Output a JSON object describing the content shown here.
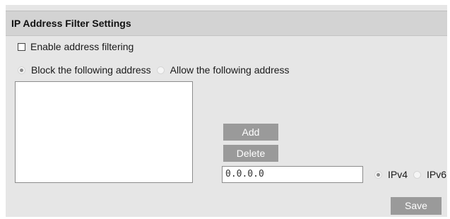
{
  "panel": {
    "title": "IP Address Filter Settings"
  },
  "enable_filter": {
    "label": "Enable address filtering",
    "checked": false
  },
  "mode": {
    "block_label": "Block the following address",
    "allow_label": "Allow the following address",
    "selected": "block"
  },
  "address_list": {
    "items": []
  },
  "buttons": {
    "add_label": "Add",
    "delete_label": "Delete",
    "save_label": "Save"
  },
  "ip_field": {
    "value": "0.0.0.0"
  },
  "ip_version": {
    "ipv4_label": "IPv4",
    "ipv6_label": "IPv6",
    "selected": "IPv4"
  }
}
